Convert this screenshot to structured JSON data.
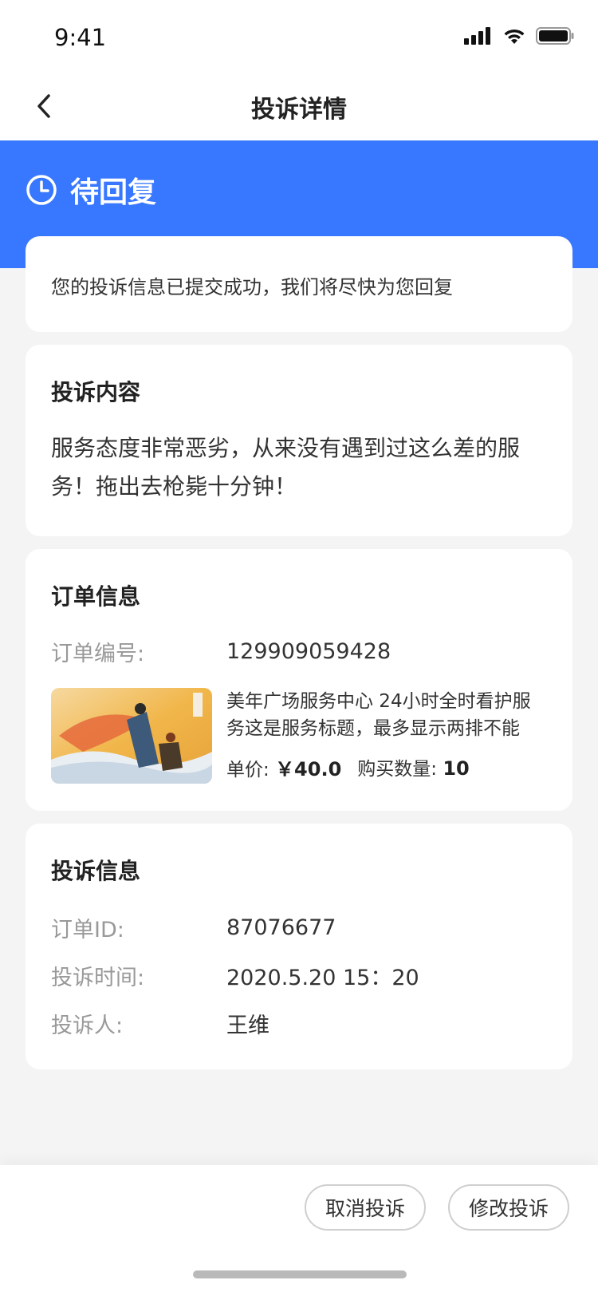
{
  "status_bar": {
    "time": "9:41"
  },
  "nav": {
    "title": "投诉详情"
  },
  "banner": {
    "status_label": "待回复",
    "color": "#3877ff"
  },
  "notice": {
    "text": "您的投诉信息已提交成功，我们将尽快为您回复"
  },
  "complaint_content": {
    "title": "投诉内容",
    "text": "服务态度非常恶劣，从来没有遇到过这么差的服务！拖出去枪毙十分钟！"
  },
  "order_info": {
    "title": "订单信息",
    "order_no_label": "订单编号:",
    "order_no_value": "129909059428",
    "product": {
      "name": "美年广场服务中心 24小时全时看护服务这是服务标题，最多显示两排不能",
      "price_label": "单价:",
      "price_value": "￥40.0",
      "qty_label": "购买数量:",
      "qty_value": "10"
    }
  },
  "complaint_info": {
    "title": "投诉信息",
    "order_id_label": "订单ID:",
    "order_id_value": "87076677",
    "time_label": "投诉时间:",
    "time_value": "2020.5.20 15：20",
    "person_label": "投诉人:",
    "person_value": "王维"
  },
  "actions": {
    "cancel_label": "取消投诉",
    "modify_label": "修改投诉"
  }
}
